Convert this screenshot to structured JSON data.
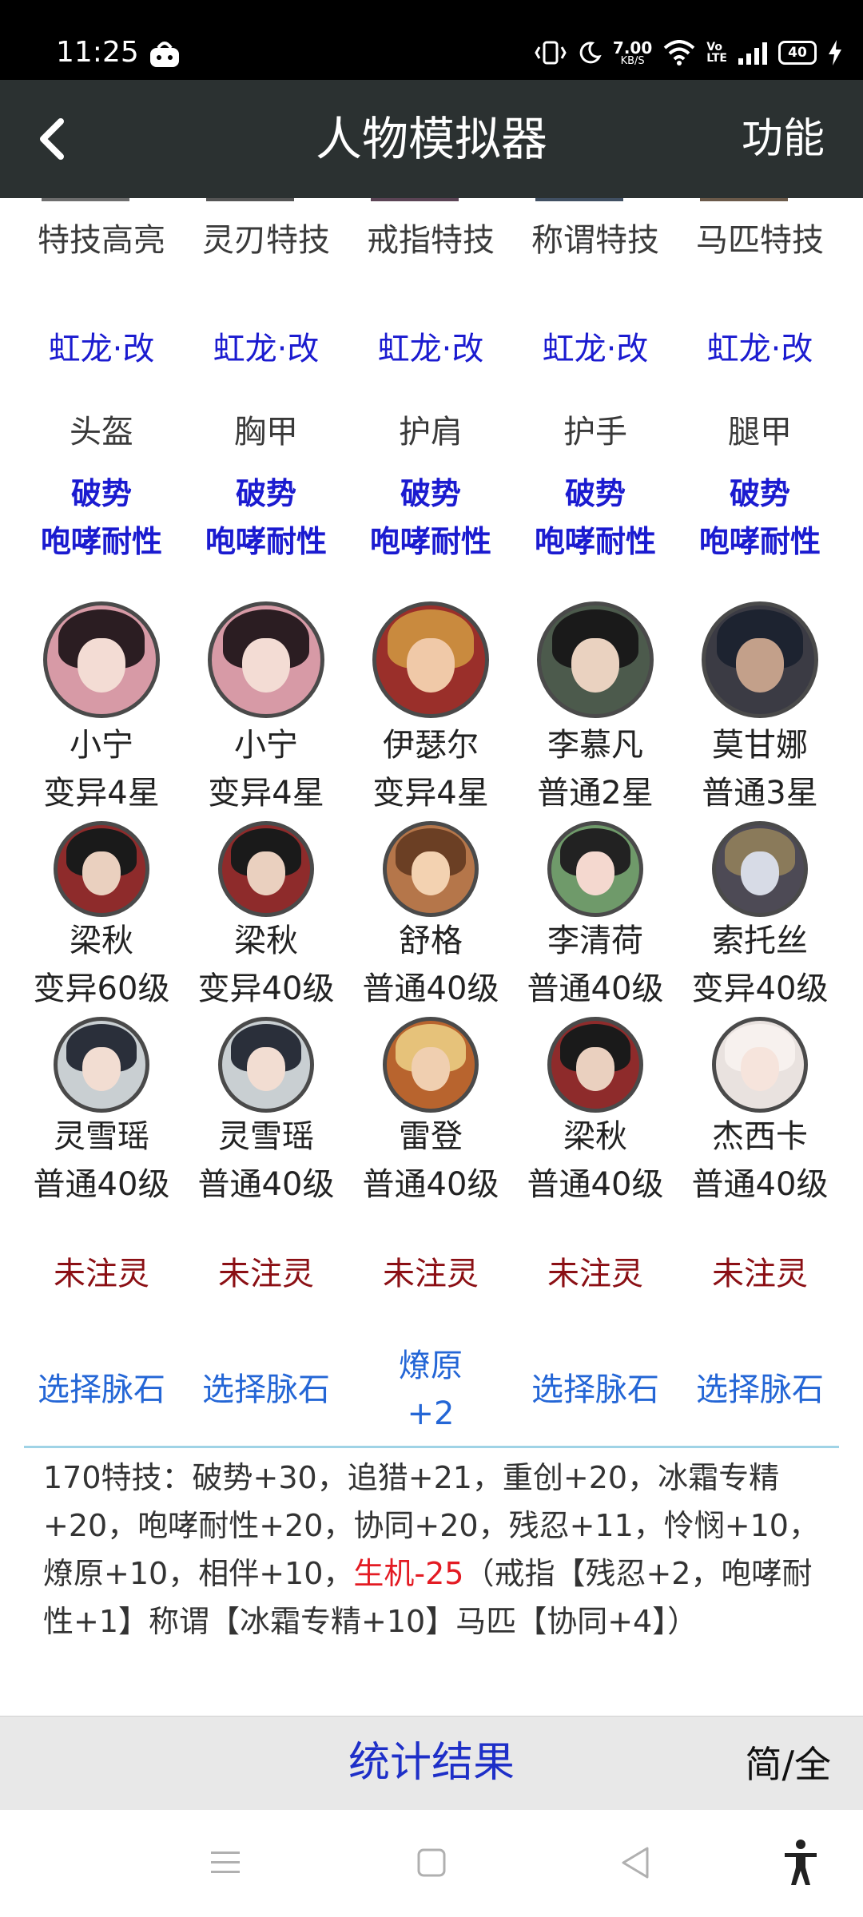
{
  "status_bar": {
    "time": "11:25",
    "speed_value": "7.00",
    "speed_unit": "KB/S",
    "volte_top": "Vo",
    "volte_bottom": "LTE",
    "battery": "40"
  },
  "app_bar": {
    "title": "人物模拟器",
    "function_label": "功能"
  },
  "skill_labels": [
    "特技高亮",
    "灵刃特技",
    "戒指特技",
    "称谓特技",
    "马匹特技"
  ],
  "armor_sets": [
    "虹龙·改",
    "虹龙·改",
    "虹龙·改",
    "虹龙·改",
    "虹龙·改"
  ],
  "armor_slots": [
    "头盔",
    "胸甲",
    "护肩",
    "护手",
    "腿甲"
  ],
  "armor_skills_line1": [
    "破势",
    "破势",
    "破势",
    "破势",
    "破势"
  ],
  "armor_skills_line2": [
    "咆哮耐性",
    "咆哮耐性",
    "咆哮耐性",
    "咆哮耐性",
    "咆哮耐性"
  ],
  "main_characters": [
    {
      "name": "小宁",
      "level": "变异4星"
    },
    {
      "name": "小宁",
      "level": "变异4星"
    },
    {
      "name": "伊瑟尔",
      "level": "变异4星"
    },
    {
      "name": "李慕凡",
      "level": "普通2星"
    },
    {
      "name": "莫甘娜",
      "level": "普通3星"
    }
  ],
  "sub_characters_row1": [
    {
      "name": "梁秋",
      "level": "变异60级"
    },
    {
      "name": "梁秋",
      "level": "变异40级"
    },
    {
      "name": "舒格",
      "level": "普通40级"
    },
    {
      "name": "李清荷",
      "level": "普通40级"
    },
    {
      "name": "索托丝",
      "level": "变异40级"
    }
  ],
  "sub_characters_row2": [
    {
      "name": "灵雪瑶",
      "level": "普通40级"
    },
    {
      "name": "灵雪瑶",
      "level": "普通40级"
    },
    {
      "name": "雷登",
      "level": "普通40级"
    },
    {
      "name": "梁秋",
      "level": "普通40级"
    },
    {
      "name": "杰西卡",
      "level": "普通40级"
    }
  ],
  "spirit_status": [
    "未注灵",
    "未注灵",
    "未注灵",
    "未注灵",
    "未注灵"
  ],
  "vein_stones": [
    {
      "line1": "选择脉石",
      "line2": ""
    },
    {
      "line1": "选择脉石",
      "line2": ""
    },
    {
      "line1": "燎原",
      "line2": "+2"
    },
    {
      "line1": "选择脉石",
      "line2": ""
    },
    {
      "line1": "选择脉石",
      "line2": ""
    }
  ],
  "summary": {
    "prefix": "170特技：破势+30，追猎+21，重创+20，冰霜专精+20，咆哮耐性+20，协同+20，残忍+11，怜悯+10，燎原+10，相伴+10，",
    "negative": "生机-25",
    "suffix": "（戒指【残忍+2，咆哮耐性+1】称谓【冰霜专精+10】马匹【协同+4】）"
  },
  "bottom_bar": {
    "stats_label": "统计结果",
    "toggle_label": "简/全"
  },
  "colors": {
    "app_bar": "#2b3131",
    "blue_text": "#1b1bd0",
    "link_text": "#2466d6",
    "maroon_text": "#8b0f14",
    "negative_text": "#e31b23",
    "divider": "#9fd3e6"
  }
}
